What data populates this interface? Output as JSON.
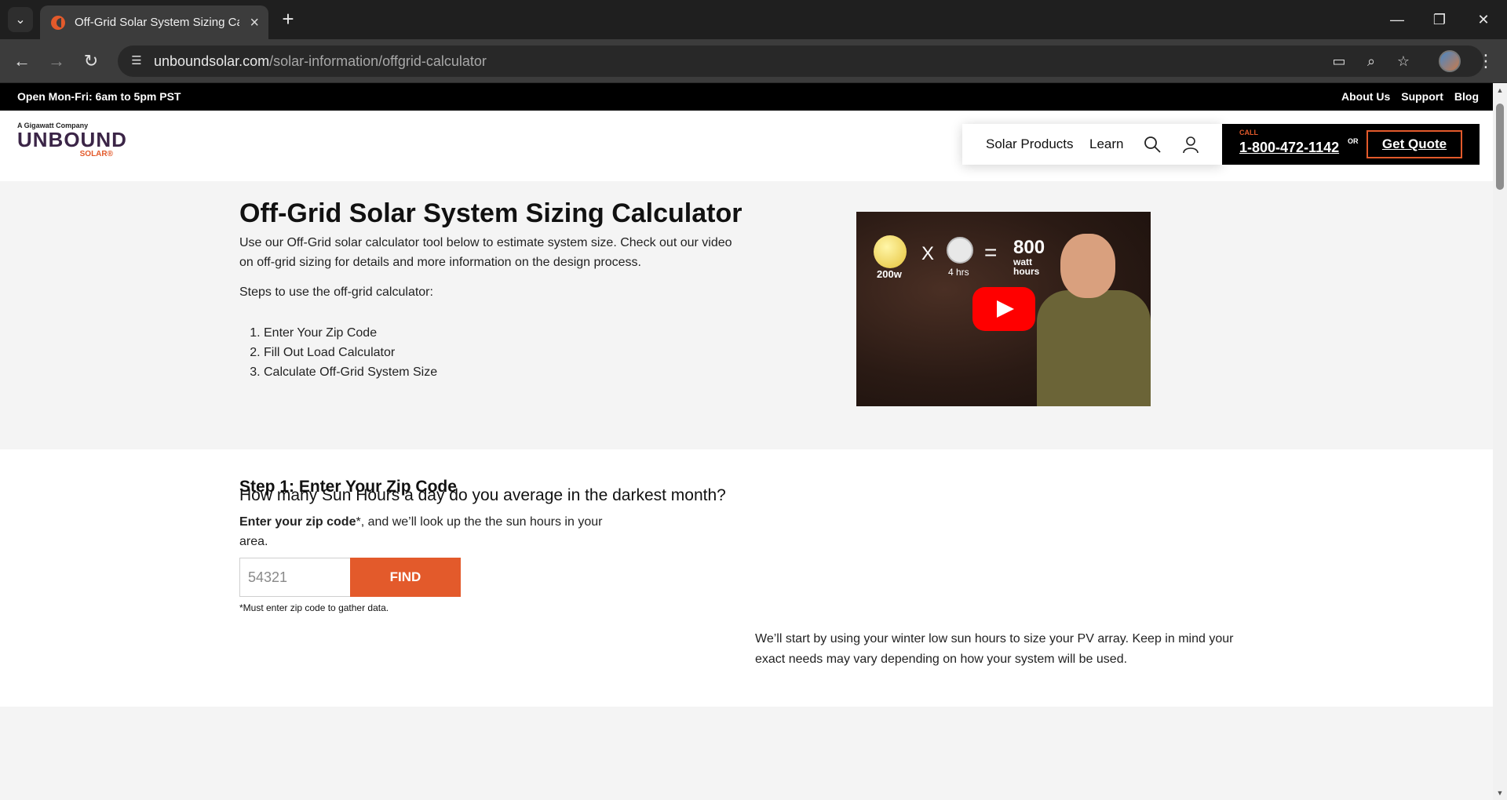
{
  "browser": {
    "tab_title": "Off-Grid Solar System Sizing Calculator",
    "url_host": "unboundsolar.com",
    "url_path": "/solar-information/offgrid-calculator"
  },
  "topbar": {
    "hours": "Open Mon-Fri: 6am to 5pm PST",
    "links": [
      "About Us",
      "Support",
      "Blog"
    ]
  },
  "logo": {
    "tagline": "A Gigawatt Company",
    "name": "UNBOUND",
    "sub": "SOLAR®"
  },
  "nav": {
    "items": [
      "Solar Products",
      "Learn"
    ],
    "call_label": "CALL",
    "phone": "1-800-472-1142",
    "or": "OR",
    "quote": "Get Quote"
  },
  "hero": {
    "title": "Off-Grid Solar System Sizing Calculator",
    "intro": "Use our Off-Grid solar calculator tool below to estimate system size. Check out our video on off-grid sizing for details and more information on the design process.",
    "steps_label": "Steps to use the off-grid calculator:",
    "steps": [
      "Enter Your Zip Code",
      "Fill Out Load Calculator",
      "Calculate Off-Grid System Size"
    ],
    "video": {
      "bulb_label": "200w",
      "times": "X",
      "clock_label": "4 hrs",
      "equals": "=",
      "result_value": "800",
      "result_unit_line1": "watt",
      "result_unit_line2": "hours"
    }
  },
  "step1": {
    "heading": "Step 1: Enter Your Zip Code",
    "desc_bold": "Enter your zip code",
    "desc_rest": "*, and we’ll look up the the sun hours in your area.",
    "zip_placeholder": "54321",
    "find_label": "FIND",
    "note": "*Must enter zip code to gather data.",
    "question": "How many Sun Hours a day do you average in the darkest month?",
    "paragraph": "We’ll start by using your winter low sun hours to size your PV array. Keep in mind your exact needs may vary depending on how your system will be used."
  },
  "colors": {
    "accent": "#e35a2b",
    "brand_purple": "#3b2547",
    "hero_bg": "#f4f4f4"
  }
}
